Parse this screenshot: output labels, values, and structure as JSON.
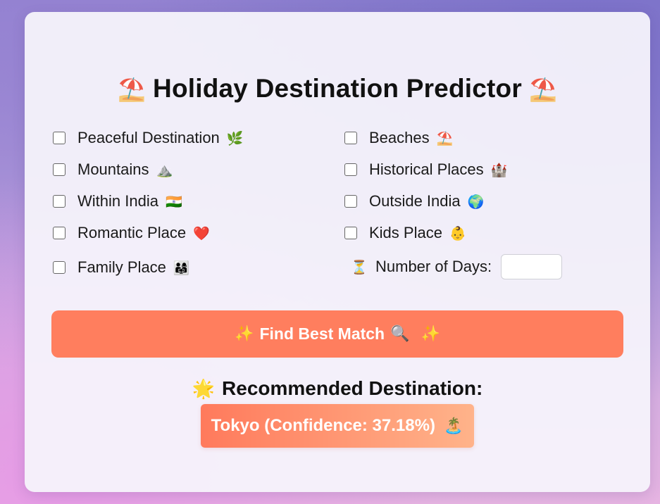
{
  "title": {
    "text": "Holiday Destination Predictor",
    "left_emoji": "⛱️",
    "right_emoji": "⛱️"
  },
  "options": [
    {
      "label": "Peaceful Destination",
      "emoji": "🌿",
      "checked": false
    },
    {
      "label": "Beaches",
      "emoji": "⛱️",
      "checked": false
    },
    {
      "label": "Mountains",
      "emoji": "⛰️",
      "checked": false
    },
    {
      "label": "Historical Places",
      "emoji": "🏰",
      "checked": false
    },
    {
      "label": "Within India",
      "emoji": "🇮🇳",
      "checked": false
    },
    {
      "label": "Outside India",
      "emoji": "🌍",
      "checked": false
    },
    {
      "label": "Romantic Place",
      "emoji": "❤️",
      "checked": false
    },
    {
      "label": "Kids Place",
      "emoji": "👶",
      "checked": false
    },
    {
      "label": "Family Place",
      "emoji": "👨‍👩‍👧",
      "checked": false
    }
  ],
  "days": {
    "emoji": "⏳",
    "label": "Number of Days:",
    "value": ""
  },
  "find_button": {
    "left_emoji": "✨",
    "label": "Find Best Match",
    "search_emoji": "🔍",
    "right_emoji": "✨"
  },
  "recommendation": {
    "emoji": "🌟",
    "heading": "Recommended Destination:",
    "result": "Tokyo (Confidence: 37.18%)",
    "result_emoji": "🏝️"
  },
  "colors": {
    "button": "#ff7e5e",
    "result_gradient_start": "#ff7a5c",
    "result_gradient_end": "#ffb38a"
  }
}
